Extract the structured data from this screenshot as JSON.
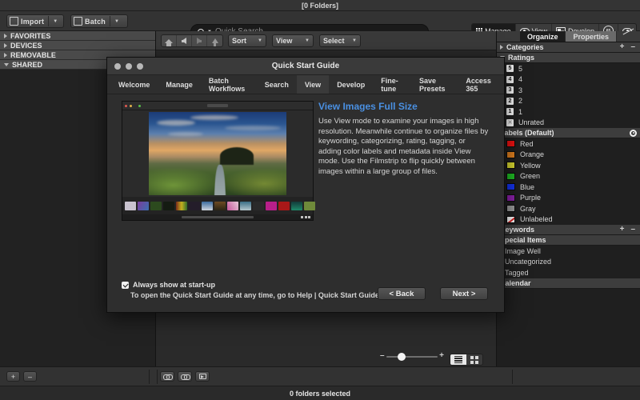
{
  "window": {
    "title": "[0 Folders]"
  },
  "toolbar": {
    "import_label": "Import",
    "batch_label": "Batch",
    "search_placeholder": "Quick Search",
    "search_value": "",
    "modes": [
      {
        "label": "Manage",
        "icon": "grid-icon",
        "active": true
      },
      {
        "label": "View",
        "icon": "eye-icon",
        "active": false
      },
      {
        "label": "Develop",
        "icon": "develop-icon",
        "active": false
      },
      {
        "label": "",
        "icon": "compare-65-icon",
        "active": false
      },
      {
        "label": "",
        "icon": "eye-slash-icon",
        "active": false
      }
    ]
  },
  "navbar": {
    "buttons": [
      {
        "icon": "home-icon"
      },
      {
        "icon": "back-arrow-icon"
      },
      {
        "icon": "forward-arrow-icon"
      },
      {
        "icon": "up-arrow-icon"
      }
    ],
    "dropdowns": [
      {
        "label": "Sort"
      },
      {
        "label": "View"
      },
      {
        "label": "Select"
      }
    ]
  },
  "sidebar": {
    "items": [
      {
        "label": "FAVORITES",
        "expanded": false
      },
      {
        "label": "DEVICES",
        "expanded": false
      },
      {
        "label": "REMOVABLE",
        "expanded": false
      },
      {
        "label": "SHARED",
        "expanded": true
      }
    ],
    "add_label": "+",
    "remove_label": "–"
  },
  "right_panel": {
    "tabs": [
      {
        "label": "Organize",
        "active": true
      },
      {
        "label": "Properties",
        "active": false
      }
    ],
    "sections": [
      {
        "title": "Categories",
        "collapsed": true,
        "add": "+",
        "remove": "–"
      },
      {
        "title": "Ratings",
        "collapsed": false
      },
      {
        "title": "Labels (Default)",
        "gear": true
      },
      {
        "title": "Keywords",
        "add": "+",
        "remove": "–"
      },
      {
        "title": "Special Items"
      },
      {
        "title": "Calendar"
      }
    ],
    "ratings": [
      {
        "box": "5",
        "label": "5"
      },
      {
        "box": "4",
        "label": "4"
      },
      {
        "box": "3",
        "label": "3"
      },
      {
        "box": "2",
        "label": "2"
      },
      {
        "box": "1",
        "label": "1"
      },
      {
        "box": "✕",
        "label": "Unrated"
      }
    ],
    "labels": [
      {
        "label": "Red",
        "color": "#ee1212"
      },
      {
        "label": "Orange",
        "color": "#e0801f"
      },
      {
        "label": "Yellow",
        "color": "#d9d831"
      },
      {
        "label": "Green",
        "color": "#1fbb24"
      },
      {
        "label": "Blue",
        "color": "#1433ee"
      },
      {
        "label": "Purple",
        "color": "#8b21a9"
      },
      {
        "label": "Gray",
        "color": "#9b9b9b"
      },
      {
        "label": "Unlabeled",
        "color": "#ffffff"
      }
    ],
    "special_items": [
      {
        "label": "Image Well"
      },
      {
        "label": "Uncategorized"
      },
      {
        "label": "Tagged"
      }
    ]
  },
  "bottom_bar": {
    "add_label": "+",
    "remove_label": "–",
    "tools": [
      {
        "icon": "link-icon"
      },
      {
        "icon": "unlink-icon"
      },
      {
        "icon": "slideshow-icon"
      }
    ],
    "zoom_minus": "–",
    "zoom_plus": "+",
    "view_toggles": [
      {
        "icon": "list-view-icon",
        "active": true
      },
      {
        "icon": "grid-view-icon",
        "active": false
      }
    ]
  },
  "status_bar": {
    "text": "0 folders selected"
  },
  "dialog": {
    "title": "Quick Start Guide",
    "tabs": [
      {
        "label": "Welcome",
        "active": false
      },
      {
        "label": "Manage",
        "active": false
      },
      {
        "label": "Batch Workflows",
        "active": false
      },
      {
        "label": "Search",
        "active": false
      },
      {
        "label": "View",
        "active": true
      },
      {
        "label": "Develop",
        "active": false
      },
      {
        "label": "Fine-tune",
        "active": false
      },
      {
        "label": "Save Presets",
        "active": false
      },
      {
        "label": "Access 365",
        "active": false
      }
    ],
    "heading": "View Images Full Size",
    "body": "Use View mode to examine your images in high resolution. Meanwhile continue to organize files by keywording, categorizing, rating, tagging, or adding color labels and metadata inside View mode. Use the Filmstrip to flip quickly between images within a large group of files.",
    "checkbox_label": "Always show at start-up",
    "checkbox_checked": true,
    "help_text": "To open the Quick Start Guide at any time, go to Help | Quick Start Guide",
    "back_label": "< Back",
    "next_label": "Next >",
    "accent_color": "#4a90e2",
    "screenshot": {
      "thumbnail_colors": [
        "#c9c3cf",
        "#7a3d9c",
        "#2c4a1e",
        "#141b12",
        "#7a2a18",
        "#241d2a",
        "#3b6c9e",
        "#6d4a22",
        "#c6569a",
        "#3a6e86",
        "#2a2a2a",
        "#b81f8a",
        "#a81818",
        "#123a3a",
        "#6f8a3a"
      ]
    }
  }
}
